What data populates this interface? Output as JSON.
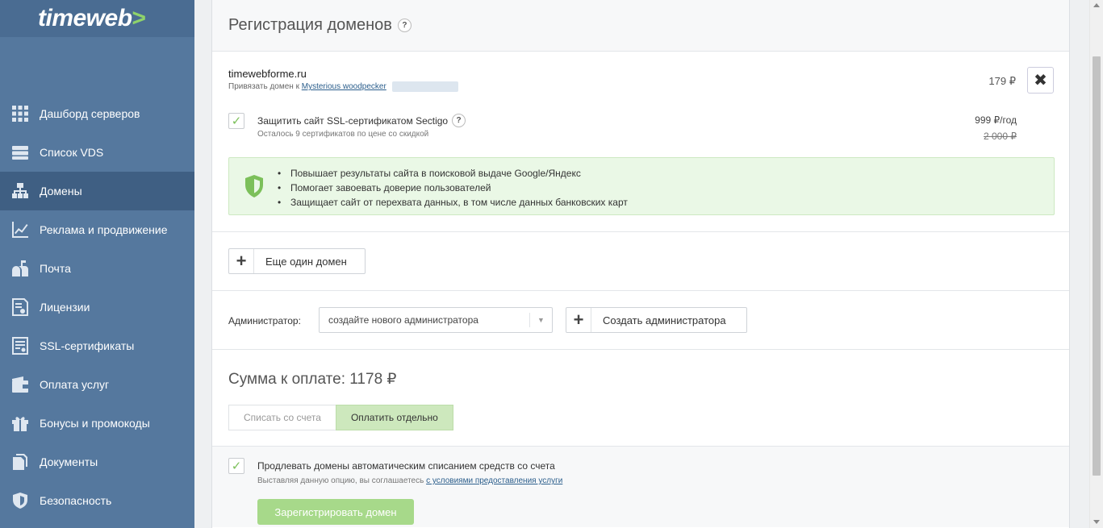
{
  "brand": {
    "logo_text": "timeweb",
    "logo_arrow": ">"
  },
  "sidebar": {
    "items": [
      {
        "label": "Дашборд серверов",
        "icon": "grid-icon"
      },
      {
        "label": "Список VDS",
        "icon": "server-icon"
      },
      {
        "label": "Домены",
        "icon": "sitemap-icon",
        "active": true
      },
      {
        "label": "Реклама и продвижение",
        "icon": "chart-icon"
      },
      {
        "label": "Почта",
        "icon": "mailbox-icon"
      },
      {
        "label": "Лицензии",
        "icon": "license-icon"
      },
      {
        "label": "SSL-сертификаты",
        "icon": "certificate-icon"
      },
      {
        "label": "Оплата услуг",
        "icon": "wallet-icon"
      },
      {
        "label": "Бонусы и промокоды",
        "icon": "gift-icon"
      },
      {
        "label": "Документы",
        "icon": "documents-icon"
      },
      {
        "label": "Безопасность",
        "icon": "shield-icon"
      }
    ]
  },
  "panel": {
    "title": "Регистрация доменов",
    "help": "?"
  },
  "domain": {
    "name": "timewebforme.ru",
    "bind_prefix": "Привязать домен к",
    "bind_link": "Mysterious woodpecker",
    "price": "179 ₽",
    "remove_icon": "✖"
  },
  "ssl": {
    "checked": true,
    "check_mark": "✓",
    "label": "Защитить сайт SSL-сертификатом Sectigo",
    "help": "?",
    "sub": "Осталось 9 сертификатов по цене со скидкой",
    "price": "999 ₽/год",
    "old_price": "2 000 ₽",
    "benefits": [
      "Повышает результаты сайта в поисковой выдаче Google/Яндекс",
      "Помогает завоевать доверие пользователей",
      "Защищает сайт от перехвата данных, в том числе данных банковских карт"
    ]
  },
  "more": {
    "plus": "+",
    "label": "Еще один домен"
  },
  "admin": {
    "label": "Администратор:",
    "select_value": "создайте нового администратора",
    "caret": "▼",
    "create_plus": "+",
    "create_label": "Создать администратора"
  },
  "sum": {
    "title": "Сумма к оплате: 1178 ₽",
    "options": [
      "Списать со счета",
      "Оплатить отдельно"
    ],
    "selected": "Оплатить отдельно"
  },
  "auto": {
    "checked": true,
    "check_mark": "✓",
    "label": "Продлевать домены автоматическим списанием средств со счета",
    "sub_prefix": "Выставляя данную опцию, вы соглашаетесь",
    "sub_link": "с условиями предоставления услуги",
    "register_button": "Зарегистрировать домен"
  },
  "colors": {
    "sidebar": "#55789e",
    "sidebar_active": "#3f5f83",
    "accent_green": "#7cc05a",
    "benefits_bg": "#eaf8e6",
    "register_button": "#a7d98a"
  }
}
